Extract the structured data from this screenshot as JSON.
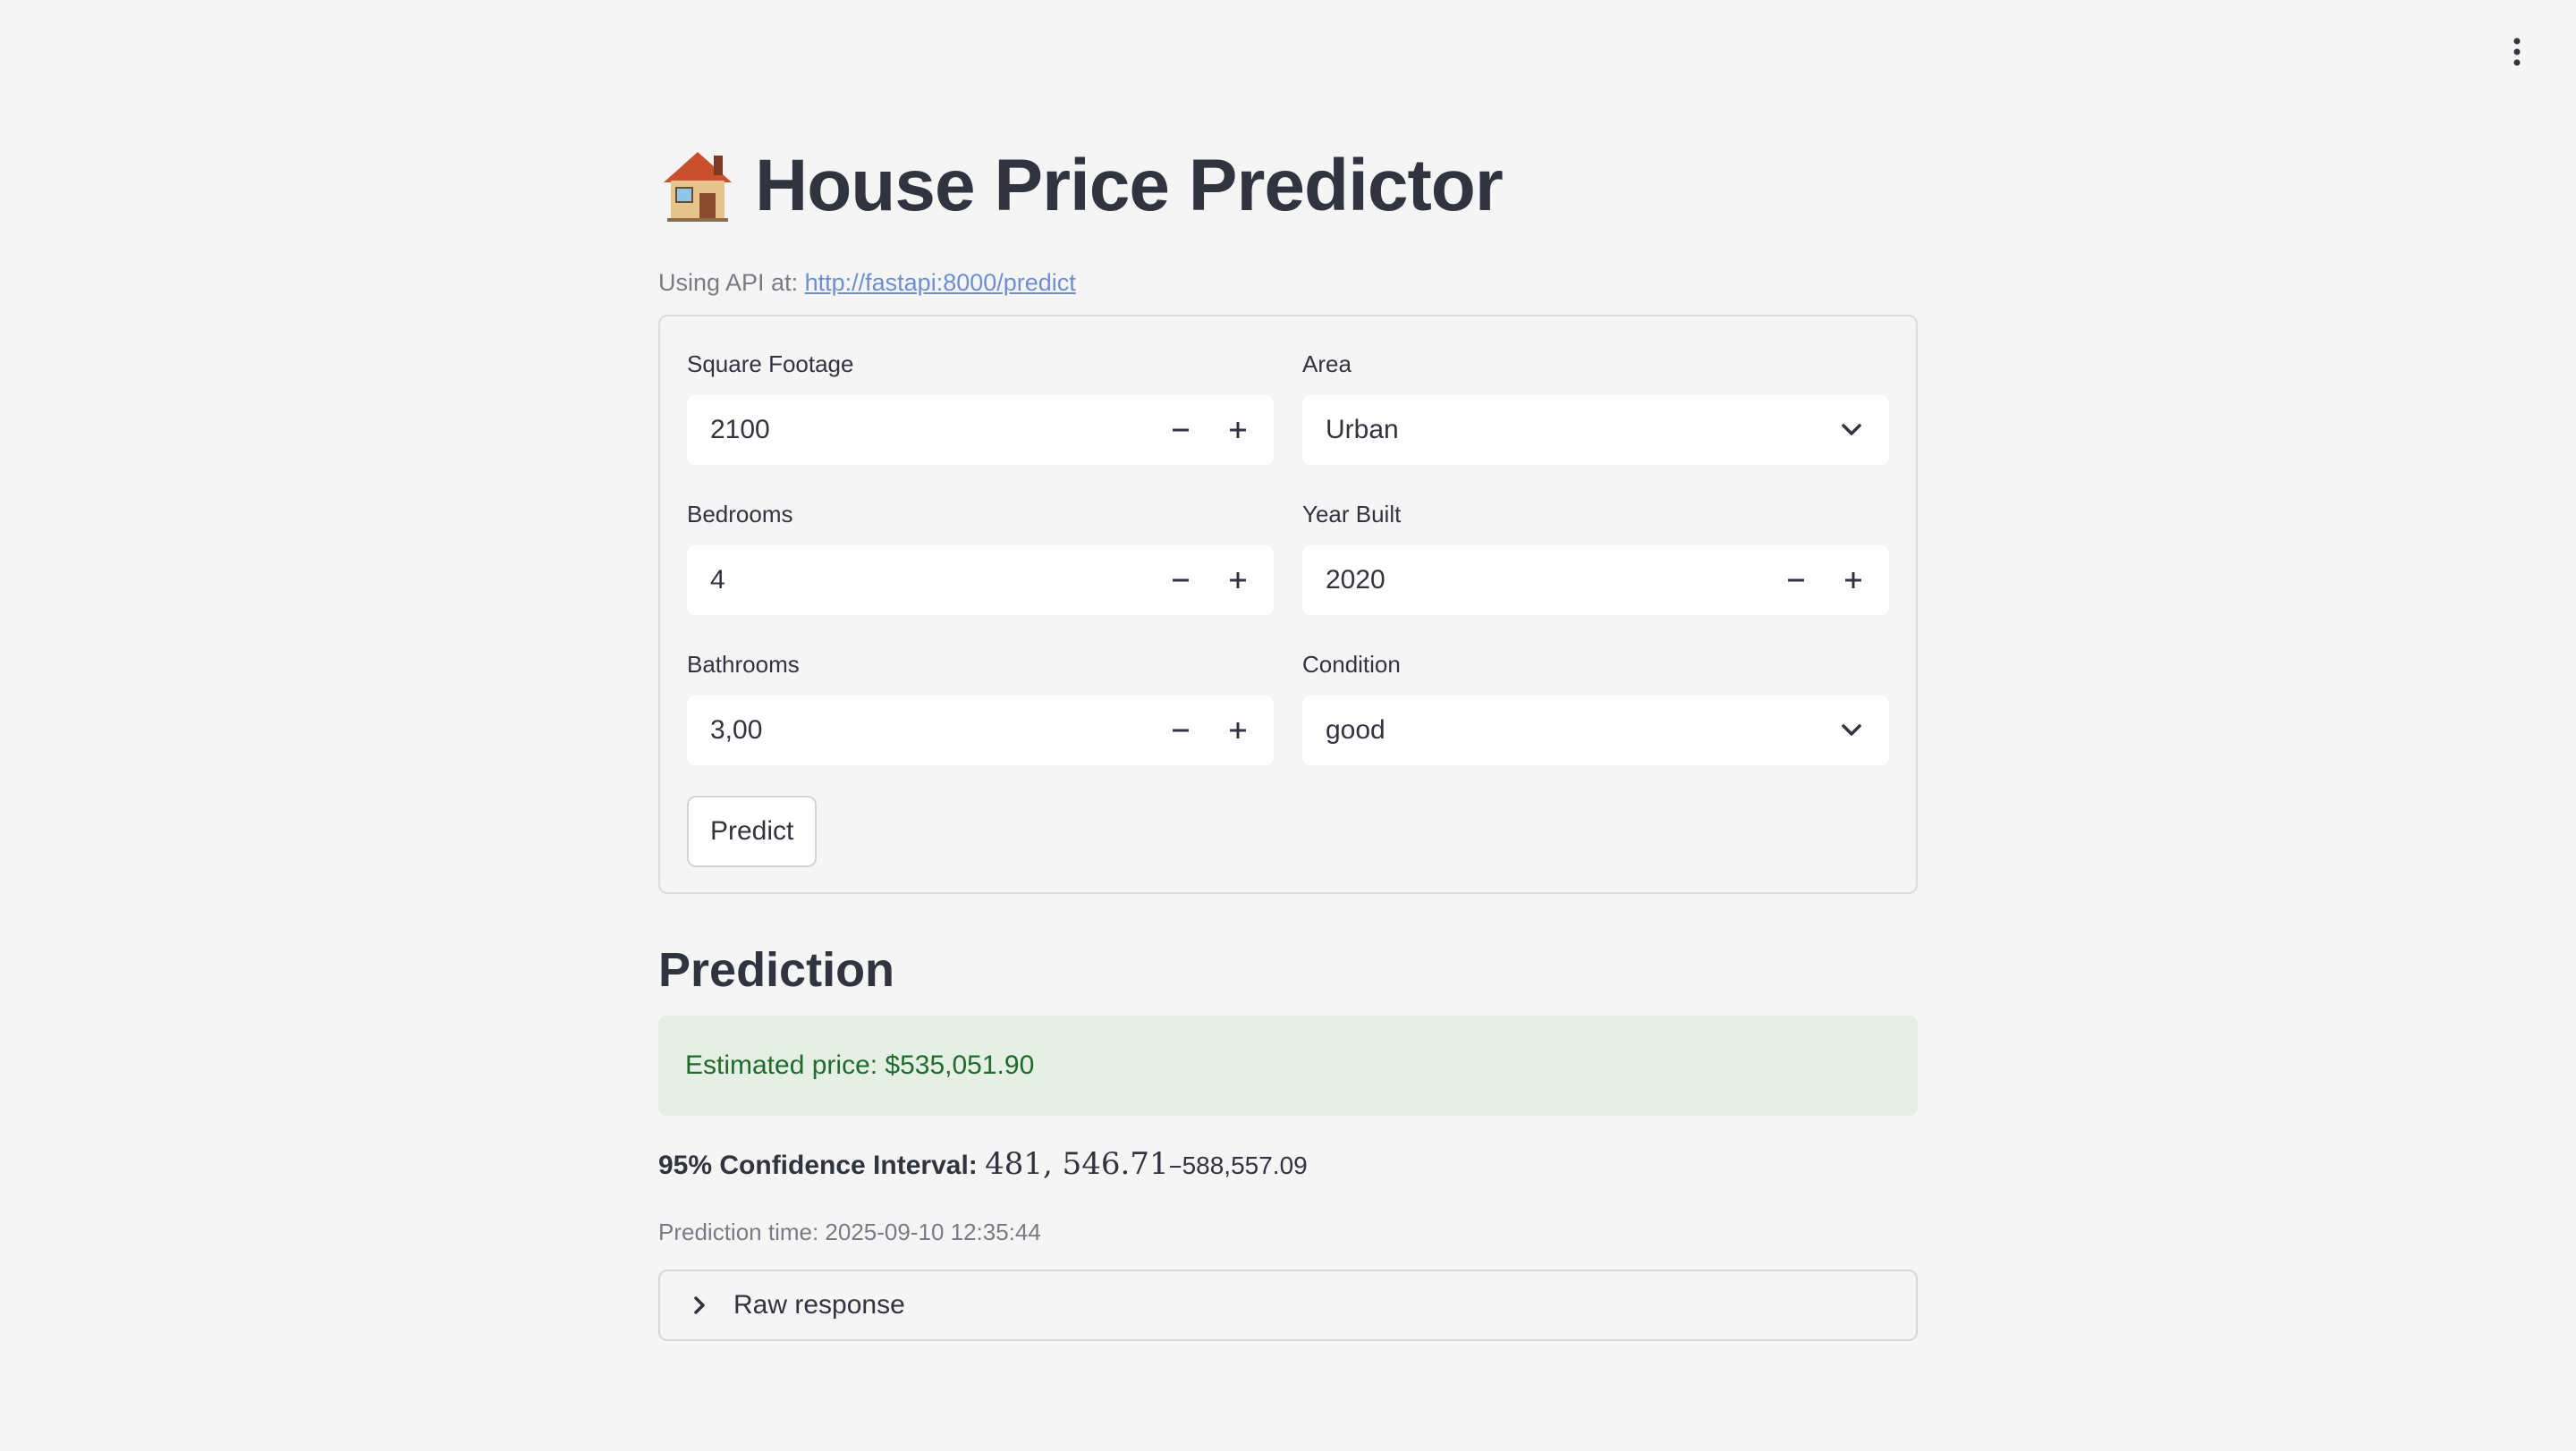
{
  "app": {
    "title_icon": "house-icon",
    "title": "House Price Predictor",
    "api_prefix": "Using API at:",
    "api_url": "http://fastapi:8000/predict",
    "menu_icon": "kebab-menu-icon"
  },
  "form": {
    "square_footage": {
      "label": "Square Footage",
      "value": "2100"
    },
    "area": {
      "label": "Area",
      "value": "Urban"
    },
    "bedrooms": {
      "label": "Bedrooms",
      "value": "4"
    },
    "year_built": {
      "label": "Year Built",
      "value": "2020"
    },
    "bathrooms": {
      "label": "Bathrooms",
      "value": "3,00"
    },
    "condition": {
      "label": "Condition",
      "value": "good"
    },
    "predict_label": "Predict"
  },
  "prediction": {
    "heading": "Prediction",
    "estimated_price": "Estimated price: $535,051.90",
    "ci_label": "95% Confidence Interval:",
    "ci_low": "481, 546.71",
    "ci_sep": "–",
    "ci_high": "588,557.09",
    "timestamp": "Prediction time: 2025-09-10 12:35:44",
    "raw_label": "Raw response"
  },
  "colors": {
    "background": "#f5f5f5",
    "success_bg": "#e5efe4",
    "success_text": "#1f6b2c",
    "link": "#6d8fd0"
  }
}
